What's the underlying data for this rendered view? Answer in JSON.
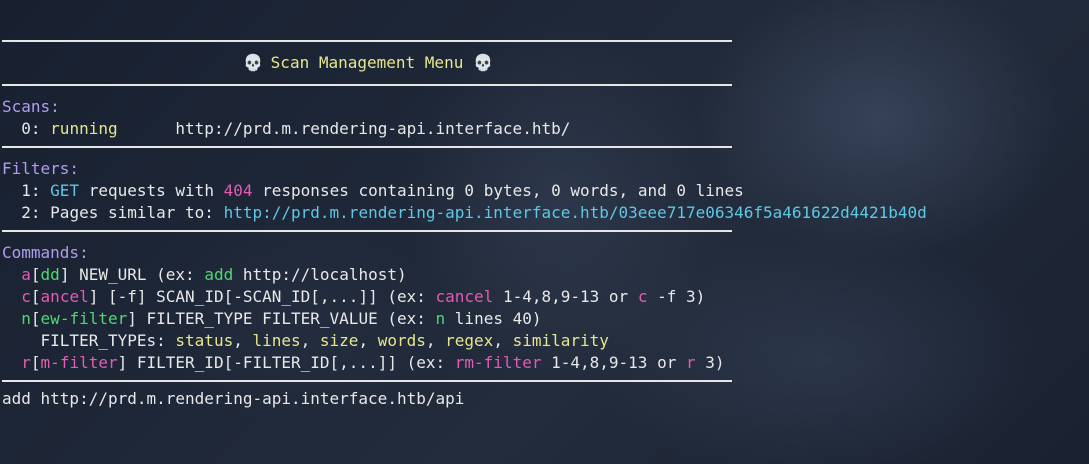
{
  "menu": {
    "title": "Scan Management Menu",
    "title_icon": "skull-icon",
    "skull_glyph": "💀"
  },
  "scans": {
    "heading": "Scans:",
    "items": [
      {
        "index": "0:",
        "status": "running",
        "url": "http://prd.m.rendering-api.interface.htb/"
      }
    ]
  },
  "filters": {
    "heading": "Filters:",
    "items": [
      {
        "index": "1:",
        "method": "GET",
        "text_a": "requests with",
        "code": "404",
        "text_b": "responses containing 0 bytes, 0 words, and 0 lines"
      },
      {
        "index": "2:",
        "text_a": "Pages similar to:",
        "url": "http://prd.m.rendering-api.interface.htb/03eee717e06346f5a461622d4421b40d"
      }
    ]
  },
  "commands": {
    "heading": "Commands:",
    "add": {
      "key": "a",
      "rest": "dd",
      "args": "NEW_URL (ex:",
      "ex_cmd": "add",
      "ex_args": "http://localhost)"
    },
    "cancel": {
      "key": "c",
      "rest": "ancel",
      "args": "[-f] SCAN_ID[-SCAN_ID[,...]] (ex:",
      "ex_cmd": "cancel",
      "ex_args": "1-4,8,9-13 or",
      "ex_short": "c",
      "ex_tail": "-f 3)"
    },
    "new_filter": {
      "key": "n",
      "rest": "ew-filter",
      "args": "FILTER_TYPE FILTER_VALUE (ex:",
      "ex_cmd": "n",
      "ex_args": "lines 40)"
    },
    "filter_types": {
      "label": "FILTER_TYPEs:",
      "values": [
        "status",
        "lines",
        "size",
        "words",
        "regex",
        "similarity"
      ]
    },
    "rm_filter": {
      "key": "r",
      "rest": "m-filter",
      "args": "FILTER_ID[-FILTER_ID[,...]] (ex:",
      "ex_cmd": "rm-filter",
      "ex_args": "1-4,8,9-13 or",
      "ex_short": "r",
      "ex_tail": "3)"
    }
  },
  "prompt": {
    "input_value": "add http://prd.m.rendering-api.interface.htb/api"
  },
  "colors": {
    "section": "#b29cf0",
    "yellow": "#e6e68c",
    "green": "#52d673",
    "pink": "#e45ab4",
    "cyan": "#5ec8e6"
  }
}
